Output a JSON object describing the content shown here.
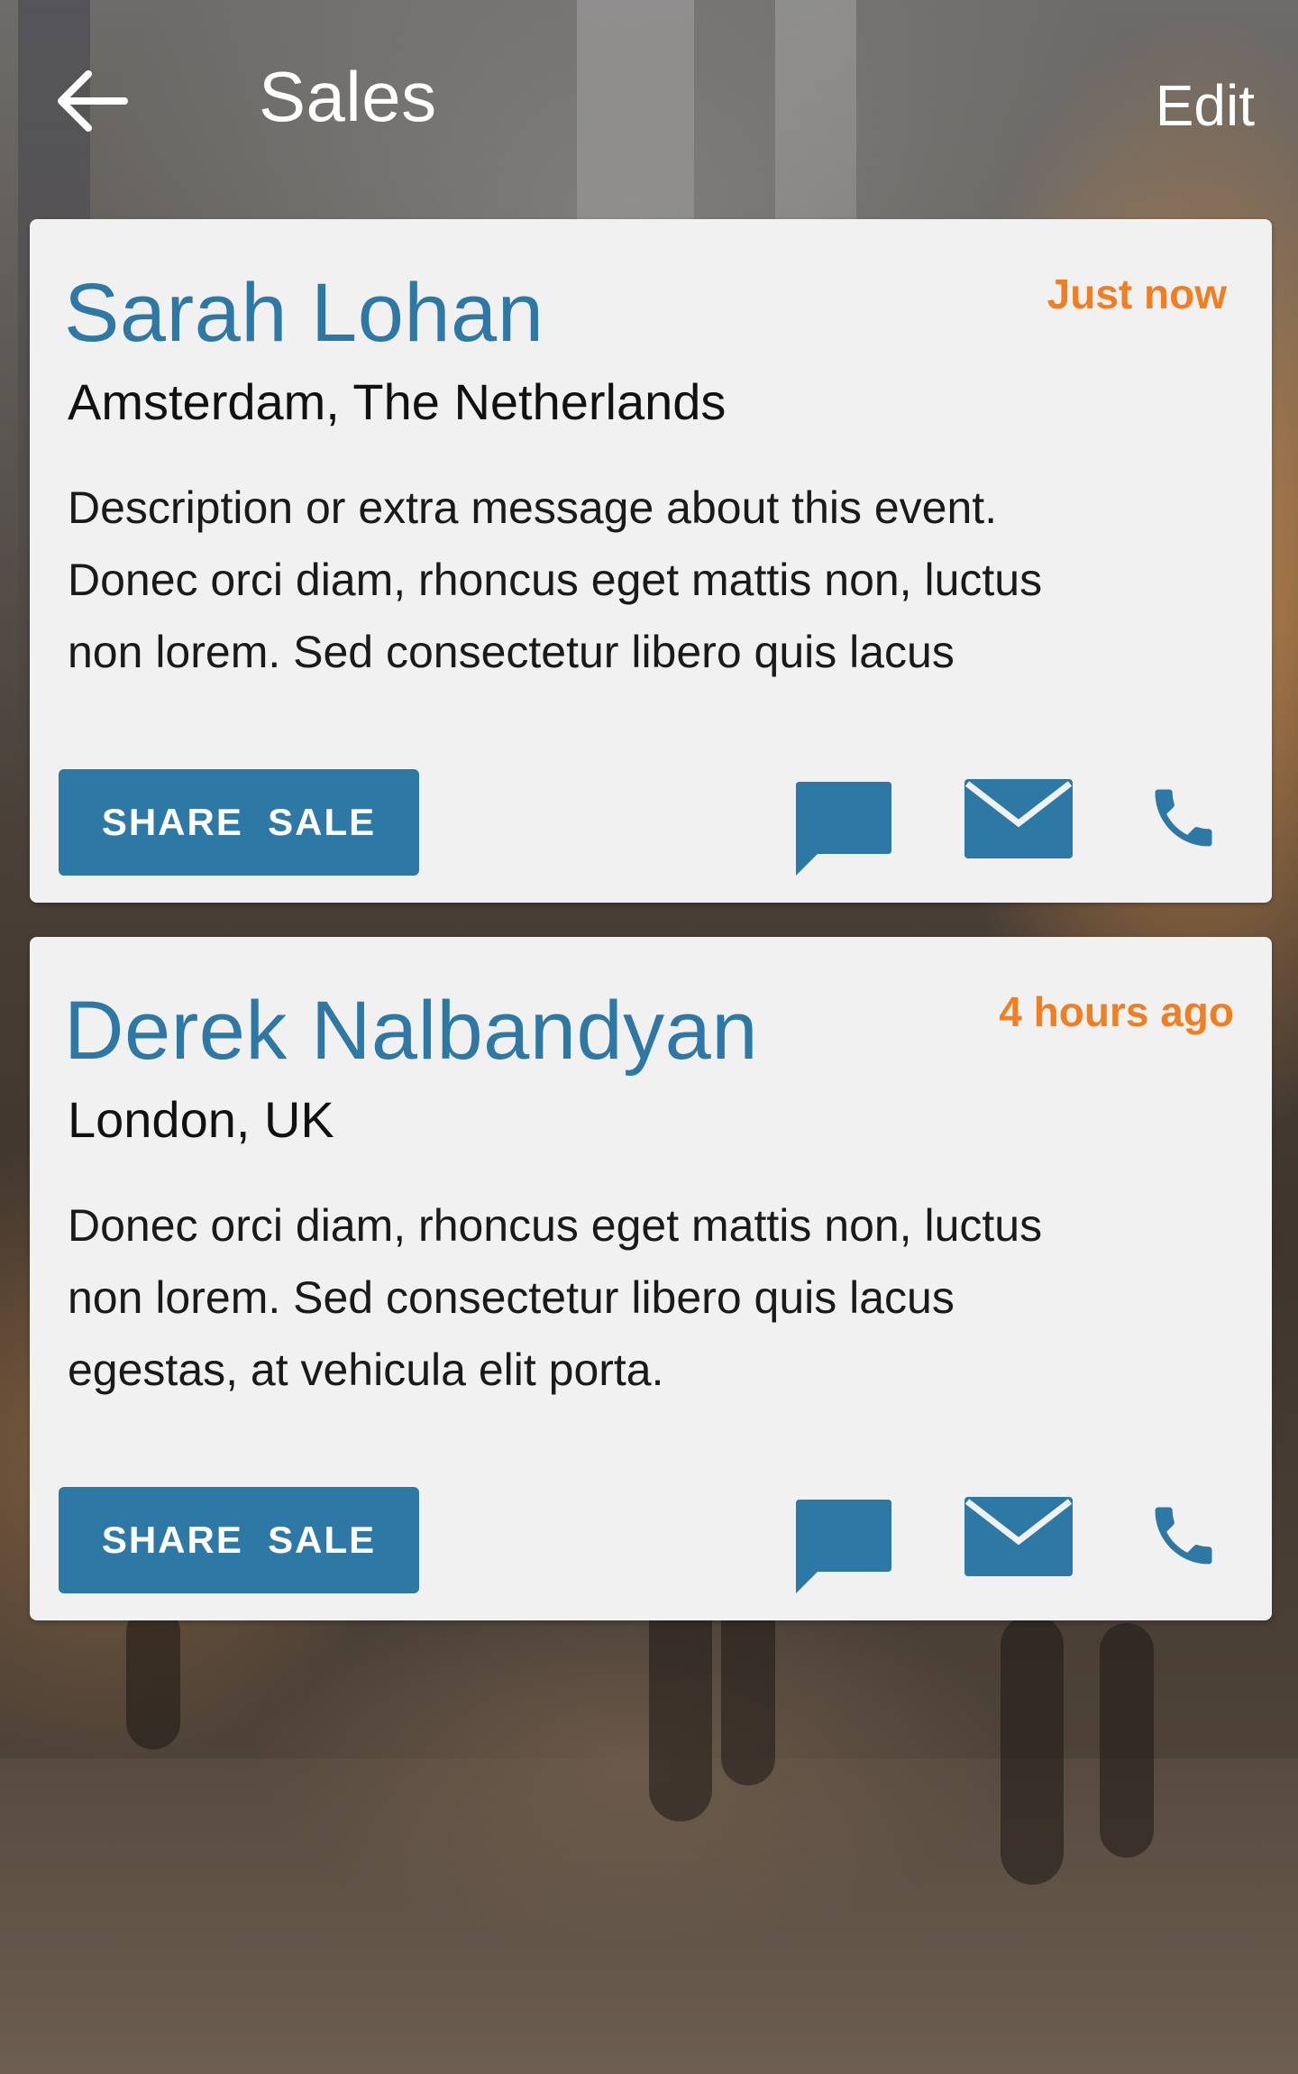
{
  "header": {
    "title": "Sales",
    "edit_label": "Edit",
    "back_icon": "arrow-left-icon"
  },
  "colors": {
    "accent": "#2e78a6",
    "timestamp": "#ef7f22",
    "card_bg": "#f1f1f1"
  },
  "sales": [
    {
      "name": "Sarah Lohan",
      "time": "Just now",
      "location": "Amsterdam, The Netherlands",
      "description_lines": [
        "Description or extra message about this event.",
        "Donec orci diam, rhoncus eget mattis non, luctus",
        "non lorem. Sed consectetur libero quis lacus"
      ],
      "share_label": "SHARE  SALE",
      "actions": [
        "chat-icon",
        "mail-icon",
        "phone-icon"
      ]
    },
    {
      "name": "Derek Nalbandyan",
      "time": "4 hours ago",
      "location": "London, UK",
      "description_lines": [
        "Donec orci diam, rhoncus eget mattis non, luctus",
        "non lorem. Sed consectetur libero quis lacus",
        "egestas, at vehicula elit porta."
      ],
      "share_label": "SHARE  SALE",
      "actions": [
        "chat-icon",
        "mail-icon",
        "phone-icon"
      ]
    }
  ]
}
